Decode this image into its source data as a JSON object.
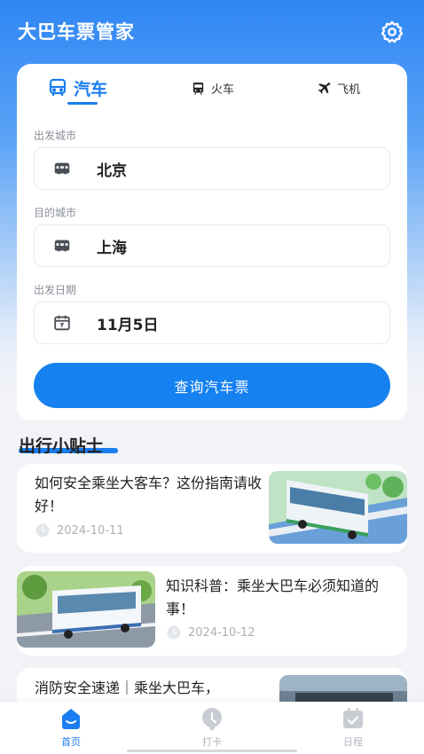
{
  "header": {
    "title": "大巴车票管家",
    "icon": "gear-icon"
  },
  "tabs": [
    {
      "label": "汽车",
      "icon": "bus-icon",
      "active": true
    },
    {
      "label": "火车",
      "icon": "train-icon",
      "active": false
    },
    {
      "label": "飞机",
      "icon": "plane-icon",
      "active": false
    }
  ],
  "form": {
    "departure_label": "出发城市",
    "departure_value": "北京",
    "destination_label": "目的城市",
    "destination_value": "上海",
    "date_label": "出发日期",
    "date_value": "11月5日",
    "search_button": "查询汽车票"
  },
  "tips": {
    "title": "出行小贴士",
    "articles": [
      {
        "title": "如何安全乘坐大客车？这份指南请收好！",
        "date": "2024-10-11"
      },
      {
        "title": "知识科普：乘坐大巴车必须知道的事！",
        "date": "2024-10-12"
      },
      {
        "title": "消防安全速递｜乘坐大巴车，"
      }
    ]
  },
  "bottom_nav": [
    {
      "label": "首页",
      "icon": "home-icon",
      "active": true
    },
    {
      "label": "打卡",
      "icon": "clock-icon",
      "active": false
    },
    {
      "label": "日程",
      "icon": "calendar-icon",
      "active": false
    }
  ],
  "colors": {
    "accent": "#1a7ef0",
    "button": "#1681f0",
    "header_gradient_top": "#2f86f4"
  }
}
